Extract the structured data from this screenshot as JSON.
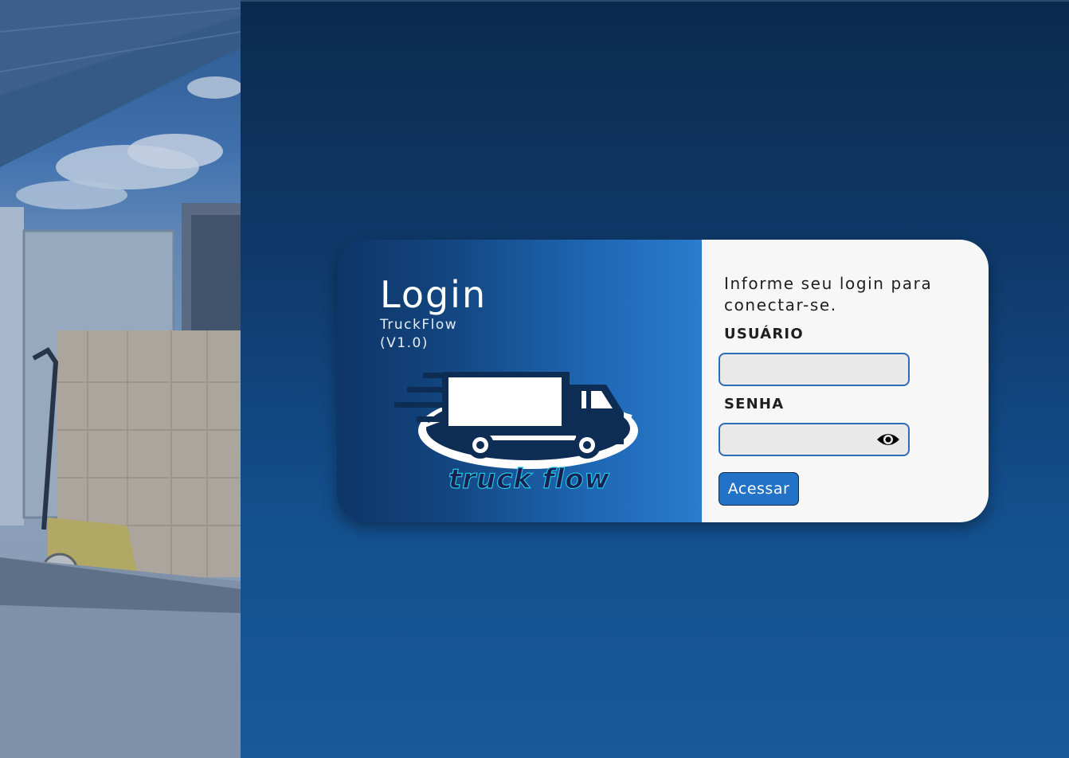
{
  "login": {
    "title": "Login",
    "app_name": "TruckFlow",
    "app_version": "(V1.0)",
    "logo_text": "truck flow"
  },
  "form": {
    "intro": "Informe seu login para conectar-se.",
    "username_label": "USUÁRIO",
    "username_value": "",
    "password_label": "SENHA",
    "password_value": "",
    "submit_label": "Acessar",
    "reveal_icon": "eye-icon"
  },
  "colors": {
    "background_top": "#0c2a4e",
    "background_bottom": "#17599a",
    "card_left_start": "#0d3567",
    "card_left_end": "#2a7ccc",
    "card_right": "#f7f7f7",
    "input_border": "#2a6db5",
    "button": "#2272c8"
  }
}
